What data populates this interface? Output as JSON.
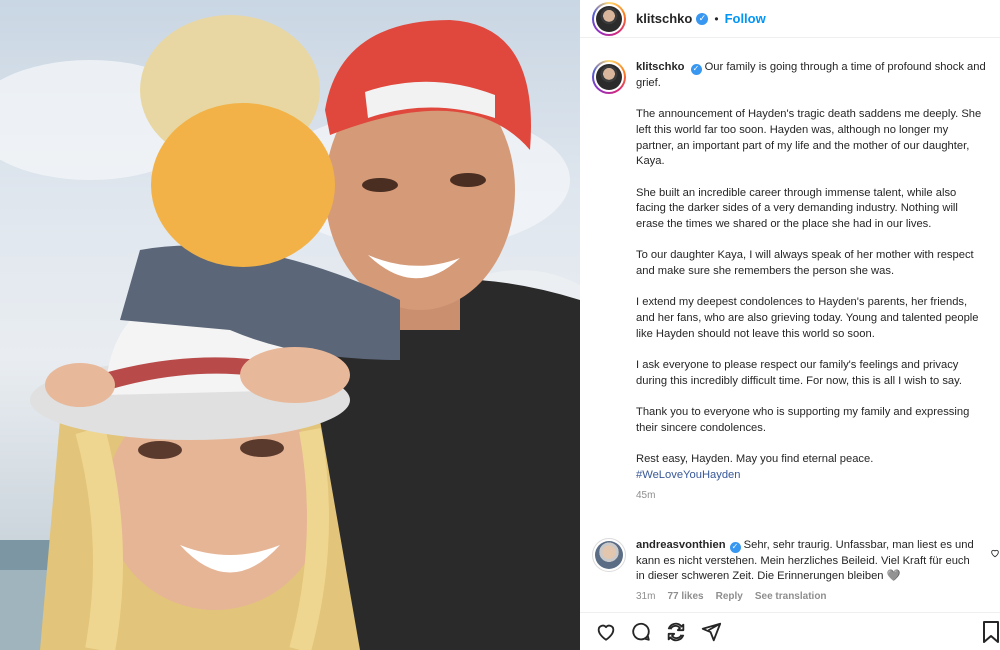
{
  "post": {
    "username": "klitschko",
    "follow_label": "Follow",
    "dot": "•",
    "caption_lead": "Our family is going through a time of profound shock and grief.",
    "paragraphs": [
      "The announcement of Hayden's tragic death saddens me deeply. She left this world far too soon. Hayden was, although no longer my partner, an important part of my life and the mother of our daughter, Kaya.",
      "She built an incredible career through immense talent, while also facing the darker sides of a very demanding industry. Nothing will erase the times we shared or the place she had in our lives.",
      "To our daughter Kaya, I will always speak of her mother with respect and make sure she remembers the person she was.",
      "I extend my deepest condolences to Hayden's parents, her friends, and her fans, who are also grieving today. Young and talented people like Hayden should not leave this world so soon.",
      "I ask everyone to please respect our family's feelings and privacy during this incredibly difficult time. For now, this is all I wish to say.",
      "Thank you to everyone who is supporting my family and expressing their sincere condolences."
    ],
    "closing": "Rest easy, Hayden. May you find eternal peace.",
    "hashtag": "#WeLoveYouHayden",
    "time": "45m"
  },
  "comment": {
    "username": "andreasvonthien",
    "text": "Sehr, sehr traurig. Unfassbar, man liest es und kann es nicht verstehen. Mein herzliches Beileid. Viel Kraft für euch in dieser schweren Zeit. Die Erinnerungen bleiben 🩶",
    "time": "31m",
    "likes": "77 likes",
    "reply_label": "Reply",
    "translate_label": "See translation"
  },
  "icons": [
    "verified-icon",
    "heart-icon",
    "comment-icon",
    "share-icon",
    "send-icon",
    "save-icon"
  ],
  "colors": {
    "follow": "#0095f6",
    "verified": "#3897f0",
    "hashtag": "#385898",
    "muted": "#8e8e8e"
  }
}
